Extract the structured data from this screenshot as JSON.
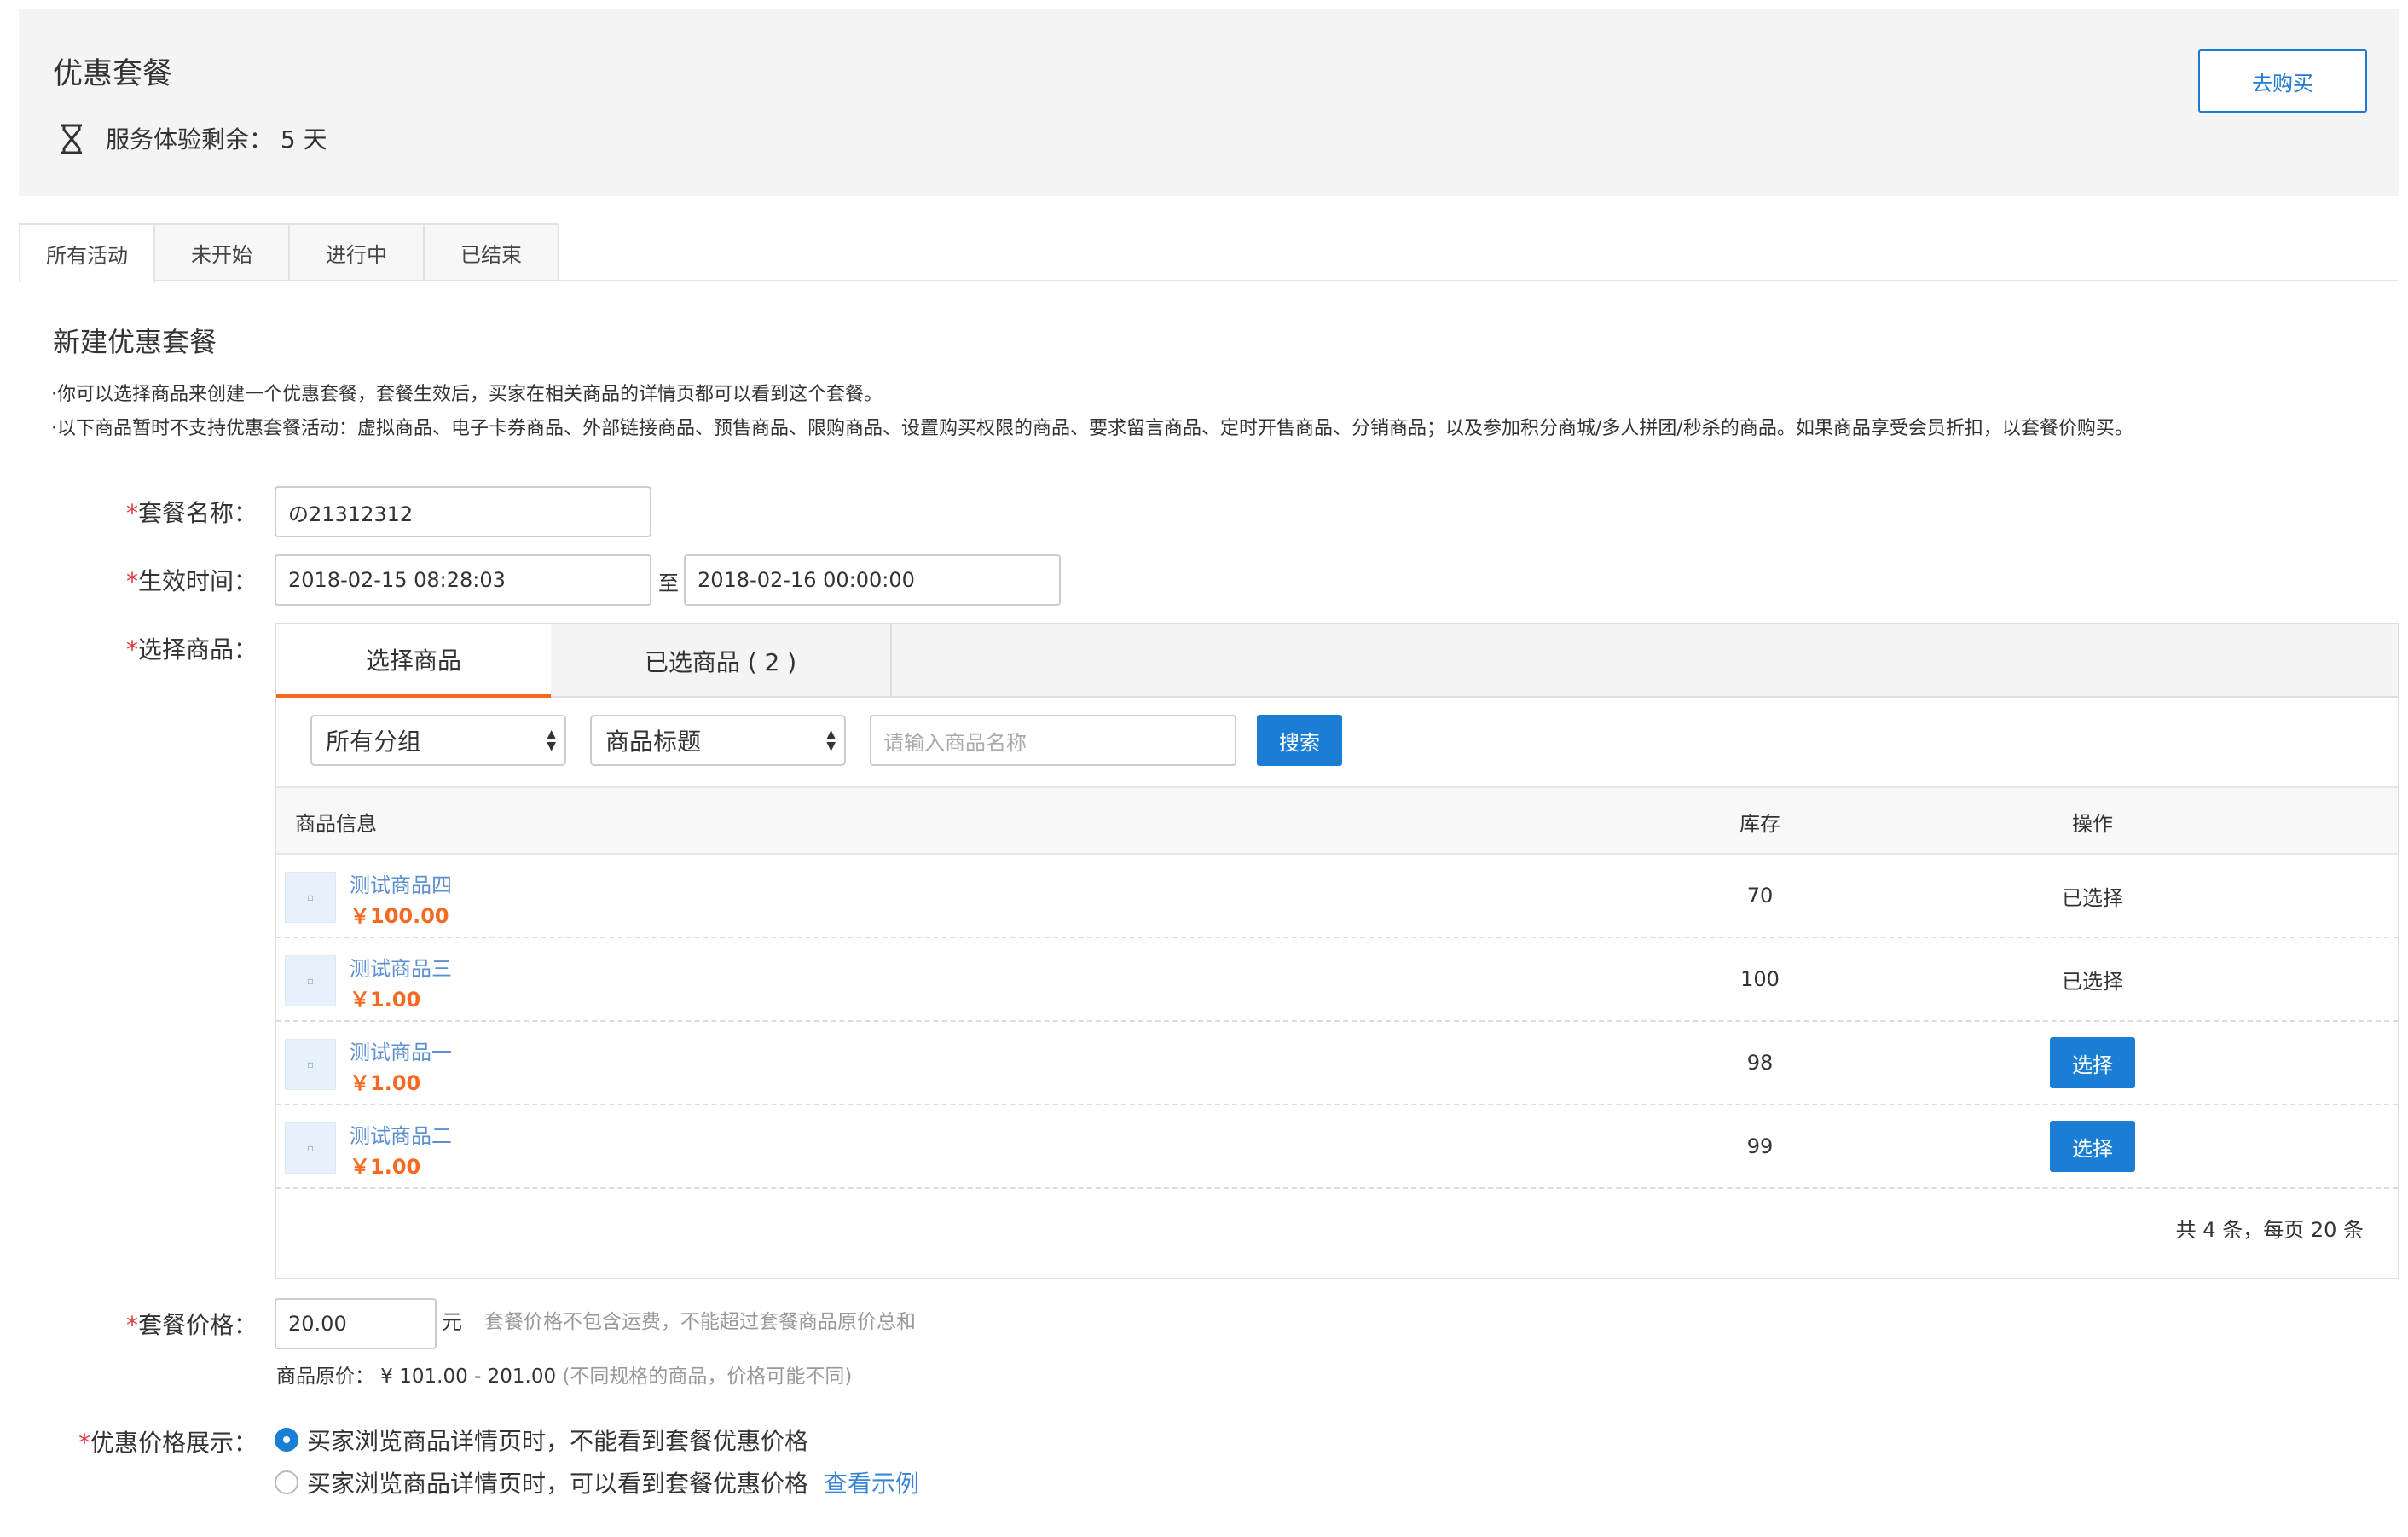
{
  "header": {
    "title": "优惠套餐",
    "trial_text": "服务体验剩余：  5 天",
    "buy_button": "去购买",
    "icon": "hourglass-icon"
  },
  "tabs": [
    {
      "label": "所有活动",
      "active": true
    },
    {
      "label": "未开始",
      "active": false
    },
    {
      "label": "进行中",
      "active": false
    },
    {
      "label": "已结束",
      "active": false
    }
  ],
  "section": {
    "title": "新建优惠套餐",
    "note1": "·你可以选择商品来创建一个优惠套餐，套餐生效后，买家在相关商品的详情页都可以看到这个套餐。",
    "note2": "·以下商品暂时不支持优惠套餐活动：虚拟商品、电子卡券商品、外部链接商品、预售商品、限购商品、设置购买权限的商品、要求留言商品、定时开售商品、分销商品；以及参加积分商城/多人拼团/秒杀的商品。如果商品享受会员折扣，以套餐价购买。"
  },
  "form": {
    "required_mark": "*",
    "name_label": "套餐名称：",
    "name_value": "の21312312",
    "time_label": "生效时间：",
    "start_time": "2018-02-15 08:28:03",
    "to_text": "至",
    "end_time": "2018-02-16 00:00:00",
    "goods_label": "选择商品：",
    "price_label": "套餐价格：",
    "price_value": "20.00",
    "price_unit": "元",
    "price_hint": "套餐价格不包含运费，不能超过套餐商品原价总和",
    "orig_price_label": "商品原价：  ¥ 101.00 - 201.00",
    "orig_price_note": "(不同规格的商品，价格可能不同)",
    "display_label": "优惠价格展示：",
    "display_option1": "买家浏览商品详情页时，不能看到套餐优惠价格",
    "display_option2": "买家浏览商品详情页时，可以看到套餐优惠价格",
    "view_example": "查看示例"
  },
  "goods": {
    "tab_select": "选择商品",
    "tab_selected": "已选商品 ( 2 )",
    "group_select": "所有分组",
    "field_select": "商品标题",
    "search_placeholder": "请输入商品名称",
    "search_button": "搜索",
    "col_info": "商品信息",
    "col_stock": "库存",
    "col_op": "操作",
    "rows": [
      {
        "name": "测试商品四",
        "price": "￥100.00",
        "stock": "70",
        "op": "已选择",
        "selected": true
      },
      {
        "name": "测试商品三",
        "price": "￥1.00",
        "stock": "100",
        "op": "已选择",
        "selected": true
      },
      {
        "name": "测试商品一",
        "price": "￥1.00",
        "stock": "98",
        "op": "选择",
        "selected": false
      },
      {
        "name": "测试商品二",
        "price": "￥1.00",
        "stock": "99",
        "op": "选择",
        "selected": false
      }
    ],
    "pager": "共 4 条，每页 20 条"
  },
  "colors": {
    "accent": "#1a7fd4",
    "price": "#f56a20",
    "required": "#e4393c",
    "link": "#5b8fd0"
  }
}
